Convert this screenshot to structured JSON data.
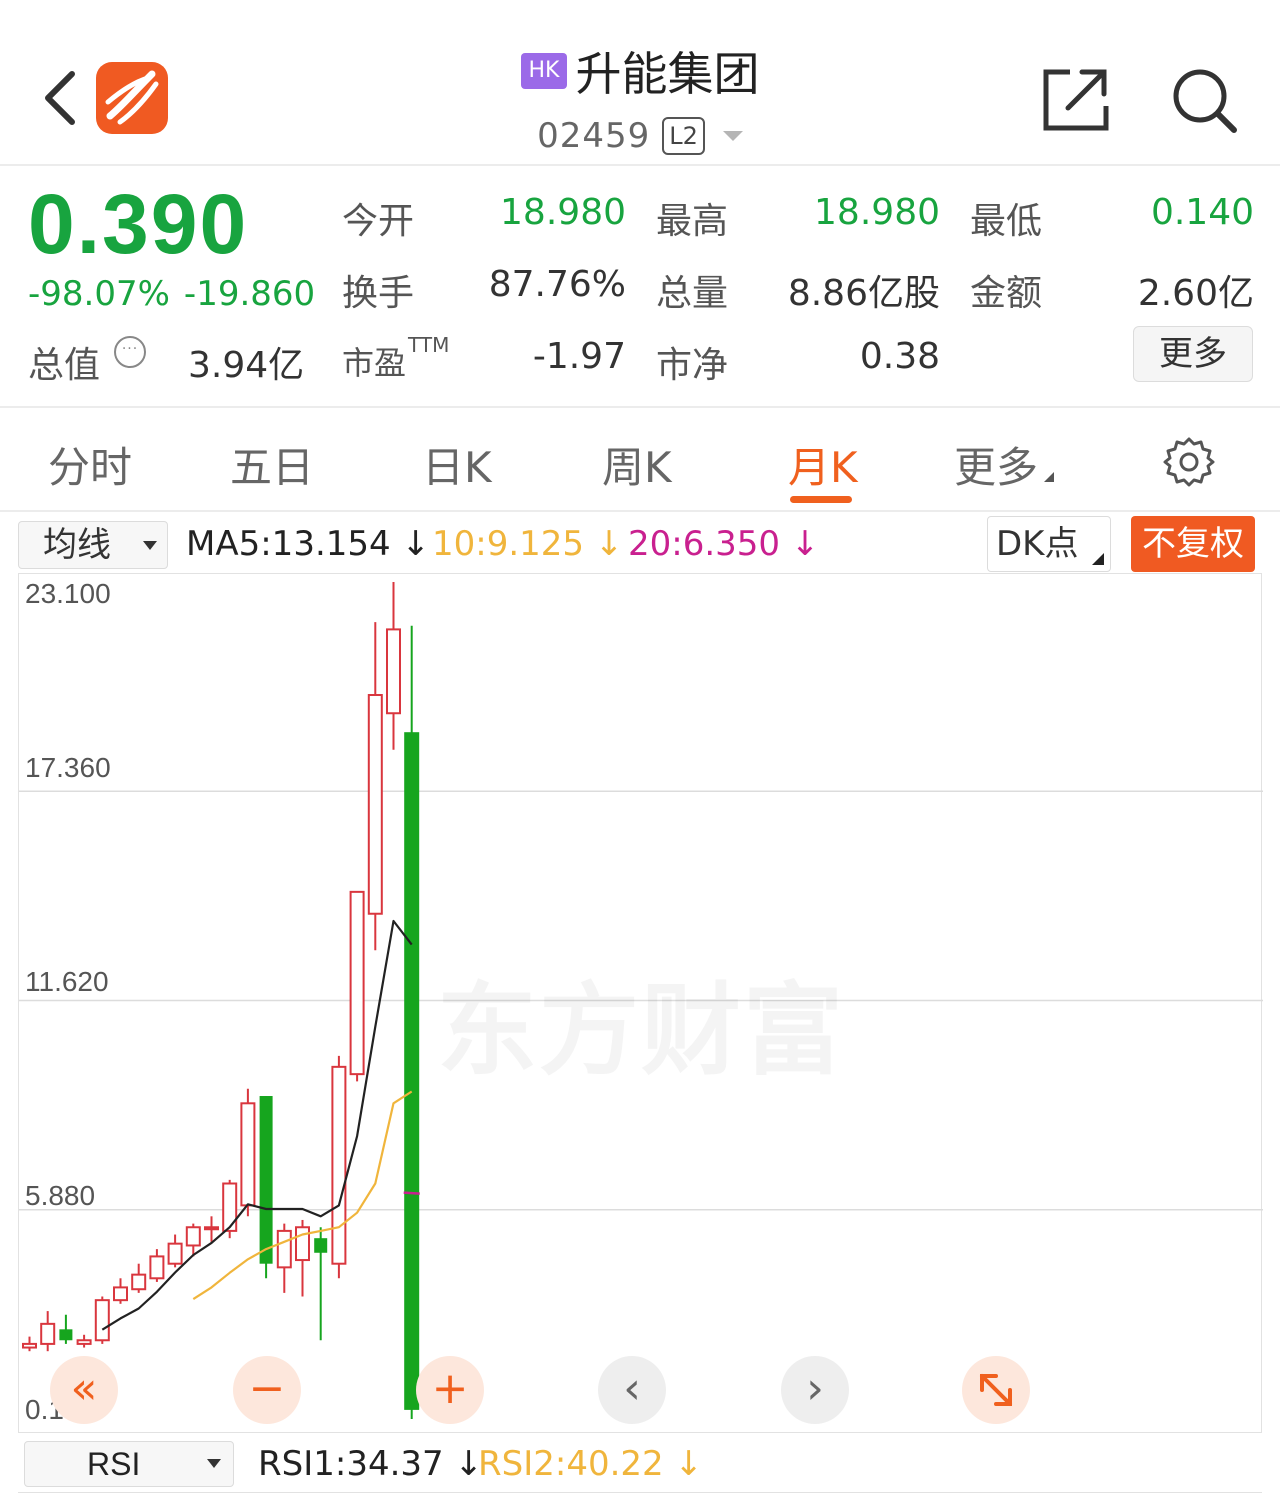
{
  "header": {
    "market_badge": "HK",
    "stock_name": "升能集团",
    "stock_code": "02459",
    "level_badge": "L2"
  },
  "quote": {
    "price": "0.390",
    "change_pct": "-98.07%",
    "change_abs": "-19.860",
    "market_cap_label": "总值",
    "market_cap_value": "3.94亿",
    "fields": {
      "open_label": "今开",
      "open_value": "18.980",
      "high_label": "最高",
      "high_value": "18.980",
      "low_label": "最低",
      "low_value": "0.140",
      "turnover_label": "换手",
      "turnover_value": "87.76%",
      "volume_label": "总量",
      "volume_value": "8.86亿股",
      "amount_label": "金额",
      "amount_value": "2.60亿",
      "pe_label": "市盈",
      "pe_suffix": "TTM",
      "pe_value": "-1.97",
      "pb_label": "市净",
      "pb_value": "0.38"
    },
    "more_label": "更多"
  },
  "tabs": [
    "分时",
    "五日",
    "日K",
    "周K",
    "月K",
    "更多"
  ],
  "active_tab": "月K",
  "indicator_bar": {
    "selector_label": "均线",
    "ma5": "MA5:13.154",
    "ma10": "10:9.125",
    "ma20": "20:6.350",
    "dk_label": "DK点",
    "adjust_label": "不复权"
  },
  "colors": {
    "up": "#d9363e",
    "down": "#16a51e",
    "price_green": "#18a43f",
    "accent_orange": "#f0601e",
    "ma5": "#222222",
    "ma10": "#f0b53c",
    "ma20": "#c9208f"
  },
  "chart_data": {
    "type": "candlestick",
    "period": "month",
    "ylim": [
      0.14,
      23.1
    ],
    "y_ticks": [
      "23.100",
      "17.360",
      "11.620",
      "5.880",
      "0.140"
    ],
    "watermark": "东方财富",
    "candles": [
      {
        "open": 2.1,
        "close": 2.2,
        "high": 2.4,
        "low": 2.0
      },
      {
        "open": 2.2,
        "close": 2.75,
        "high": 3.1,
        "low": 2.0
      },
      {
        "open": 2.6,
        "close": 2.3,
        "high": 3.0,
        "low": 2.2
      },
      {
        "open": 2.2,
        "close": 2.3,
        "high": 2.45,
        "low": 2.1
      },
      {
        "open": 2.3,
        "close": 3.4,
        "high": 3.5,
        "low": 2.2
      },
      {
        "open": 3.4,
        "close": 3.75,
        "high": 4.0,
        "low": 3.3
      },
      {
        "open": 3.7,
        "close": 4.1,
        "high": 4.4,
        "low": 3.6
      },
      {
        "open": 4.0,
        "close": 4.6,
        "high": 4.8,
        "low": 3.9
      },
      {
        "open": 4.4,
        "close": 4.95,
        "high": 5.2,
        "low": 4.3
      },
      {
        "open": 4.9,
        "close": 5.4,
        "high": 5.5,
        "low": 4.6
      },
      {
        "open": 5.4,
        "close": 5.4,
        "high": 5.7,
        "low": 5.0
      },
      {
        "open": 5.3,
        "close": 6.6,
        "high": 6.7,
        "low": 5.1
      },
      {
        "open": 6.0,
        "close": 8.8,
        "high": 9.2,
        "low": 5.7
      },
      {
        "open": 9.0,
        "close": 4.4,
        "high": 9.0,
        "low": 4.0
      },
      {
        "open": 4.3,
        "close": 5.3,
        "high": 5.5,
        "low": 3.6
      },
      {
        "open": 4.5,
        "close": 5.4,
        "high": 5.6,
        "low": 3.5
      },
      {
        "open": 5.1,
        "close": 4.7,
        "high": 5.4,
        "low": 2.3
      },
      {
        "open": 4.4,
        "close": 9.8,
        "high": 10.1,
        "low": 4.0
      },
      {
        "open": 9.6,
        "close": 14.6,
        "high": 14.6,
        "low": 9.4
      },
      {
        "open": 14.0,
        "close": 20.0,
        "high": 22.0,
        "low": 13.0
      },
      {
        "open": 19.5,
        "close": 21.8,
        "high": 23.1,
        "low": 18.5
      },
      {
        "open": 18.98,
        "close": 0.39,
        "high": 21.9,
        "low": 0.14
      }
    ],
    "ma5_values": [
      null,
      null,
      null,
      null,
      2.59,
      2.9,
      3.17,
      3.63,
      4.16,
      4.64,
      4.97,
      5.4,
      6.03,
      5.9,
      5.9,
      5.9,
      5.7,
      6.0,
      7.9,
      10.9,
      13.8,
      13.154
    ],
    "ma10_values": [
      null,
      null,
      null,
      null,
      null,
      null,
      null,
      null,
      null,
      3.43,
      3.75,
      4.15,
      4.52,
      4.8,
      5.0,
      5.2,
      5.3,
      5.4,
      5.8,
      6.6,
      8.8,
      9.125
    ],
    "ma20_last": 6.35
  },
  "controls": {
    "rewind": "«",
    "zoom_out": "−",
    "zoom_in": "+",
    "prev": "‹",
    "next": "›"
  },
  "rsi_bar": {
    "selector_label": "RSI",
    "rsi1": "RSI1:34.37",
    "rsi2": "RSI2:40.22"
  }
}
